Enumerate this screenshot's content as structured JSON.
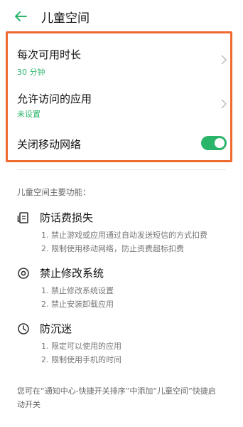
{
  "header": {
    "title": "儿童空间"
  },
  "settings": {
    "time_limit": {
      "label": "每次可用时长",
      "value": "30 分钟"
    },
    "allowed_apps": {
      "label": "允许访问的应用",
      "value": "未设置"
    },
    "mobile_network": {
      "label": "关闭移动网络",
      "enabled": true
    }
  },
  "features": {
    "section_title": "儿童空间主要功能：",
    "items": [
      {
        "icon": "phone-bill-icon",
        "title": "防话费损失",
        "desc": [
          "1. 禁止游戏或应用通过自动发送短信的方式扣费",
          "2. 限制使用移动网络，防止资费超标扣费"
        ]
      },
      {
        "icon": "settings-ring-icon",
        "title": "禁止修改系统",
        "desc": [
          "1. 禁止修改系统设置",
          "2. 禁止安装卸载应用"
        ]
      },
      {
        "icon": "clock-icon",
        "title": "防沉迷",
        "desc": [
          "1. 限定可以使用的应用",
          "2. 限制使用手机的时间"
        ]
      }
    ]
  },
  "footer_note": "您可在“通知中心-快捷开关排序”中添加“儿童空间”快捷启动开关",
  "colors": {
    "accent": "#2bb56b",
    "highlight": "#ee6a2e"
  }
}
